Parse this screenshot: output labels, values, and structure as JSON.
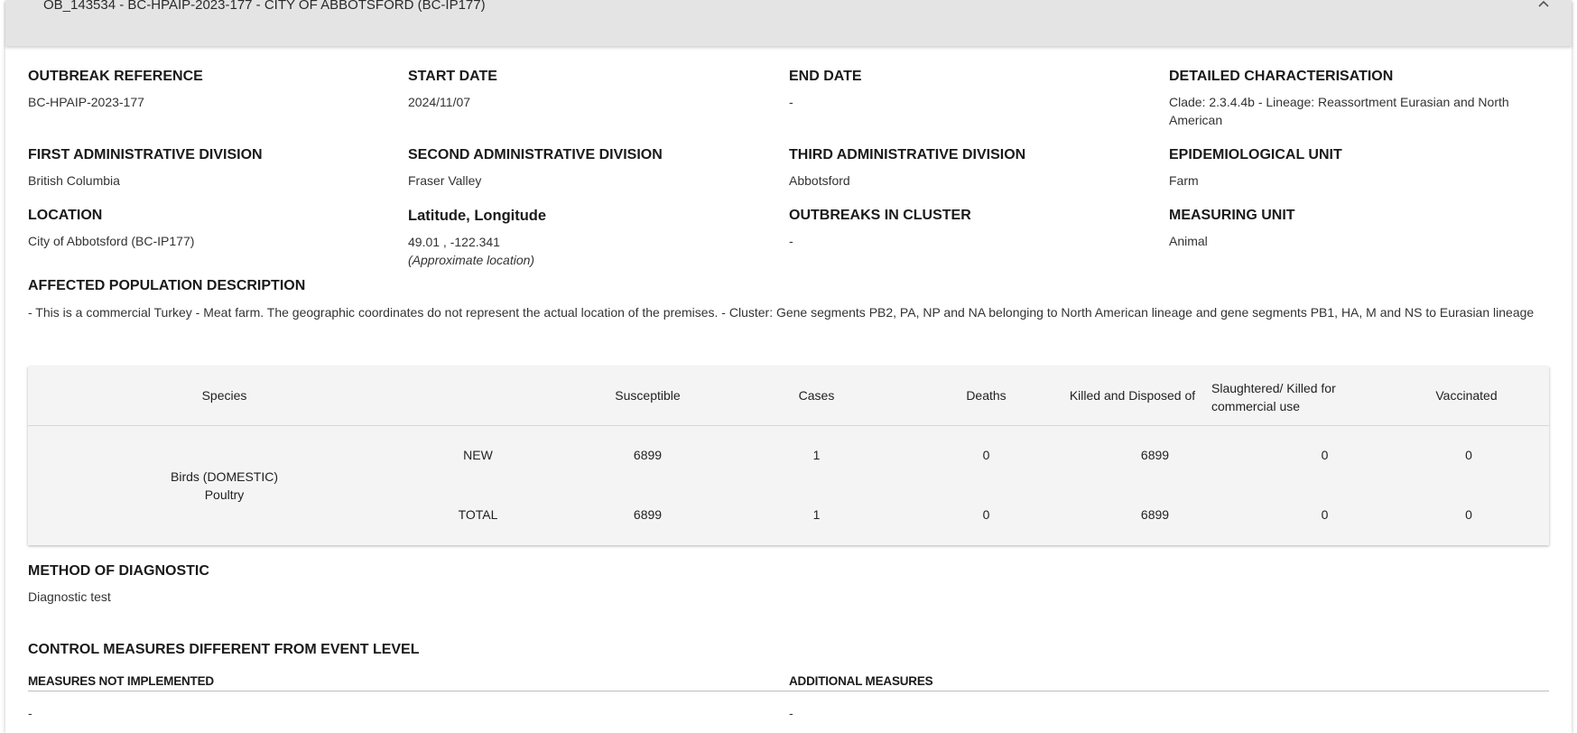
{
  "header": {
    "title": "OB_143534 - BC-HPAIP-2023-177 - CITY OF ABBOTSFORD (BC-IP177)"
  },
  "fields": {
    "outbreak_reference": {
      "label": "OUTBREAK REFERENCE",
      "value": "BC-HPAIP-2023-177"
    },
    "start_date": {
      "label": "START DATE",
      "value": "2024/11/07"
    },
    "end_date": {
      "label": "END DATE",
      "value": "-"
    },
    "detailed_characterisation": {
      "label": "DETAILED CHARACTERISATION",
      "value": "Clade: 2.3.4.4b - Lineage: Reassortment Eurasian and North American"
    },
    "first_admin": {
      "label": "FIRST ADMINISTRATIVE DIVISION",
      "value": "British Columbia"
    },
    "second_admin": {
      "label": "SECOND ADMINISTRATIVE DIVISION",
      "value": "Fraser Valley"
    },
    "third_admin": {
      "label": "THIRD ADMINISTRATIVE DIVISION",
      "value": "Abbotsford"
    },
    "epi_unit": {
      "label": "EPIDEMIOLOGICAL UNIT",
      "value": "Farm"
    },
    "location": {
      "label": "LOCATION",
      "value": "City of Abbotsford (BC-IP177)"
    },
    "lat_lon": {
      "label": "Latitude, Longitude",
      "value": "49.01 , -122.341",
      "note": "(Approximate location)"
    },
    "outbreaks_in_cluster": {
      "label": "OUTBREAKS IN CLUSTER",
      "value": "-"
    },
    "measuring_unit": {
      "label": "MEASURING UNIT",
      "value": "Animal"
    }
  },
  "affected_population": {
    "label": "AFFECTED POPULATION DESCRIPTION",
    "text": "- This is a commercial Turkey - Meat farm. The geographic coordinates do not represent the actual location of the premises. - Cluster: Gene segments PB2, PA, NP and NA belonging to North American lineage and gene segments PB1, HA, M and NS to Eurasian lineage"
  },
  "table": {
    "headers": {
      "species": "Species",
      "susceptible": "Susceptible",
      "cases": "Cases",
      "deaths": "Deaths",
      "killed": "Killed and Disposed of",
      "slaughtered": "Slaughtered/ Killed for commercial use",
      "vaccinated": "Vaccinated"
    },
    "species_line1": "Birds (DOMESTIC)",
    "species_line2": "Poultry",
    "rows": [
      {
        "type": "NEW",
        "susceptible": "6899",
        "cases": "1",
        "deaths": "0",
        "killed": "6899",
        "slaughtered": "0",
        "vaccinated": "0"
      },
      {
        "type": "TOTAL",
        "susceptible": "6899",
        "cases": "1",
        "deaths": "0",
        "killed": "6899",
        "slaughtered": "0",
        "vaccinated": "0"
      }
    ]
  },
  "method_of_diagnostic": {
    "label": "METHOD OF DIAGNOSTIC",
    "value": "Diagnostic test"
  },
  "control_measures": {
    "label": "CONTROL MEASURES DIFFERENT FROM EVENT LEVEL",
    "not_implemented_label": "MEASURES NOT IMPLEMENTED",
    "not_implemented_value": "-",
    "additional_label": "ADDITIONAL MEASURES",
    "additional_value": "-"
  }
}
